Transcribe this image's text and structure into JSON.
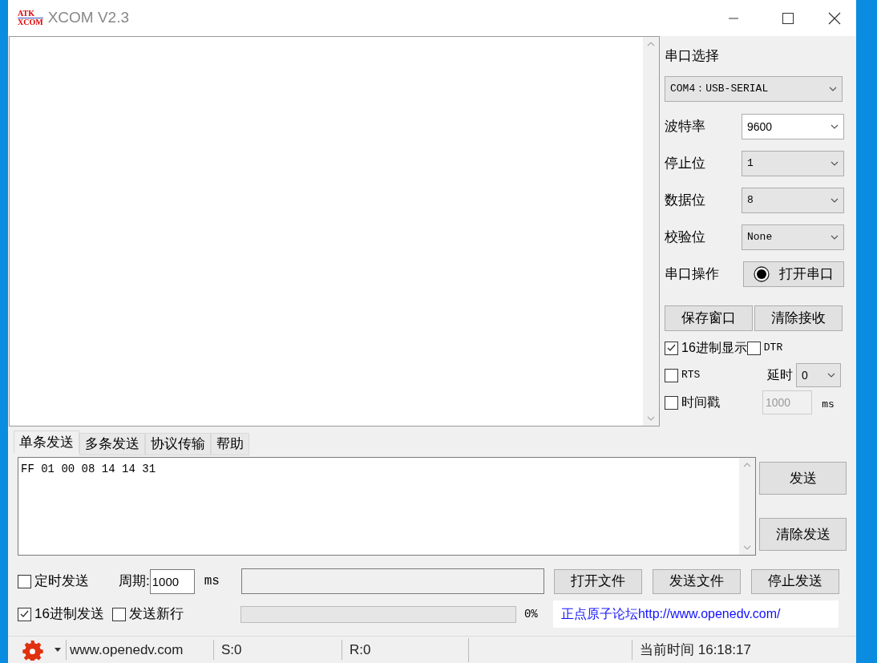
{
  "window": {
    "title": "XCOM V2.3",
    "logo_lines": [
      "ATK",
      "XCOM"
    ]
  },
  "serial_panel": {
    "port_label": "串口选择",
    "port_value": "COM4：USB-SERIAL",
    "settings": [
      {
        "label": "波特率",
        "value": "9600",
        "kind": "editable"
      },
      {
        "label": "停止位",
        "value": "1",
        "kind": "select"
      },
      {
        "label": "数据位",
        "value": "8",
        "kind": "select"
      },
      {
        "label": "校验位",
        "value": "None",
        "kind": "select"
      }
    ],
    "operation_label": "串口操作",
    "open_button": "打开串口",
    "buttons": [
      "保存窗口",
      "清除接收"
    ],
    "hex_display": {
      "label": "16进制显示",
      "checked": true
    },
    "dtr": {
      "label": "DTR",
      "checked": false
    },
    "rts": {
      "label": "RTS",
      "checked": false
    },
    "delay": {
      "label": "延时",
      "value": "0"
    },
    "timestamp": {
      "label": "时间戳",
      "checked": false,
      "interval": "1000",
      "unit": "ms"
    }
  },
  "tabs": [
    {
      "label": "单条发送",
      "selected": true
    },
    {
      "label": "多条发送",
      "selected": false
    },
    {
      "label": "协议传输",
      "selected": false
    },
    {
      "label": "帮助",
      "selected": false
    }
  ],
  "send": {
    "text": "FF 01 00 08 14 14 31",
    "buttons": [
      "发送",
      "清除发送"
    ],
    "timed_send": {
      "label": "定时发送",
      "checked": false
    },
    "period_label": "周期:",
    "period_value": "1000",
    "period_unit": "ms",
    "file_buttons": [
      "打开文件",
      "发送文件",
      "停止发送"
    ],
    "hex_send": {
      "label": "16进制发送",
      "checked": true
    },
    "send_newline": {
      "label": "发送新行",
      "checked": false
    },
    "progress": {
      "level": 0
    },
    "progress_text": "0%",
    "forum_link": "正点原子论坛http://www.openedv.com/"
  },
  "status_bar": {
    "site": "www.openedv.com",
    "sent": "S:0",
    "received": "R:0",
    "time": "当前时间 16:18:17"
  }
}
